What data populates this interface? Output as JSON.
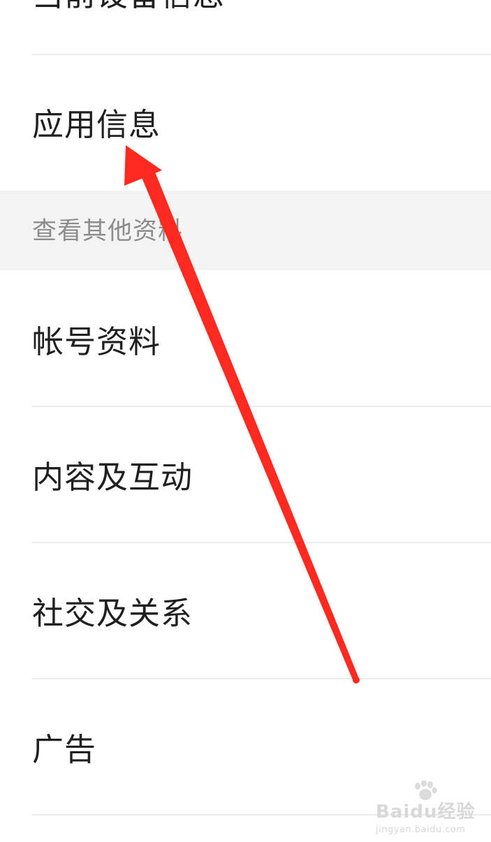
{
  "items": {
    "top_partial": "当前设备信息",
    "app_info": "应用信息",
    "account_info": "帐号资料",
    "content_interaction": "内容及互动",
    "social_relations": "社交及关系",
    "ads": "广告"
  },
  "section_header": "查看其他资料",
  "annotation": {
    "type": "red-arrow",
    "color": "#ff2a1f",
    "points_to": "应用信息"
  },
  "watermark": {
    "brand": "Baidu经验",
    "url": "jingyan.baidu.com"
  }
}
